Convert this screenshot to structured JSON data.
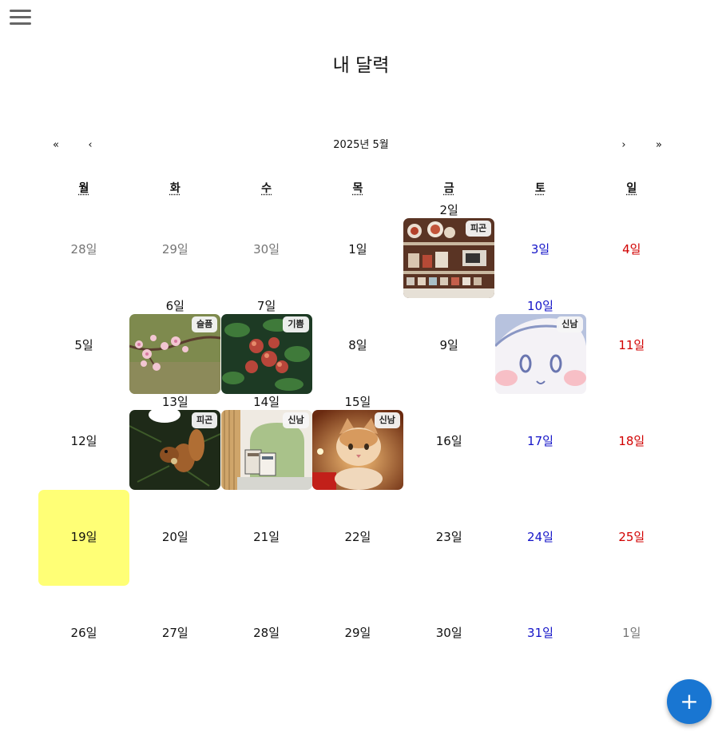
{
  "title": "내 달력",
  "nav": {
    "prev_year": "«",
    "prev_month": "‹",
    "month_label": "2025년 5월",
    "next_month": "›",
    "next_year": "»"
  },
  "weekdays": [
    "월",
    "화",
    "수",
    "목",
    "금",
    "토",
    "일"
  ],
  "weeks": [
    [
      {
        "label": "28일",
        "color": "grey"
      },
      {
        "label": "29일",
        "color": "grey"
      },
      {
        "label": "30일",
        "color": "grey"
      },
      {
        "label": "1일",
        "color": "black"
      },
      {
        "label": "2일",
        "color": "black",
        "tag": "피곤",
        "photo": "kitchen-shelves"
      },
      {
        "label": "3일",
        "color": "blue"
      },
      {
        "label": "4일",
        "color": "red"
      }
    ],
    [
      {
        "label": "5일",
        "color": "black"
      },
      {
        "label": "6일",
        "color": "black",
        "tag": "슬픔",
        "photo": "cherry-blossom"
      },
      {
        "label": "7일",
        "color": "black",
        "tag": "기쁨",
        "photo": "apple-tree"
      },
      {
        "label": "8일",
        "color": "black"
      },
      {
        "label": "9일",
        "color": "black"
      },
      {
        "label": "10일",
        "color": "blue",
        "tag": "신남",
        "photo": "cartoon-face"
      },
      {
        "label": "11일",
        "color": "red"
      }
    ],
    [
      {
        "label": "12일",
        "color": "black"
      },
      {
        "label": "13일",
        "color": "black",
        "tag": "피곤",
        "photo": "squirrel"
      },
      {
        "label": "14일",
        "color": "black",
        "tag": "신남",
        "photo": "books-chair"
      },
      {
        "label": "15일",
        "color": "black",
        "tag": "신남",
        "photo": "kitten"
      },
      {
        "label": "16일",
        "color": "black"
      },
      {
        "label": "17일",
        "color": "blue"
      },
      {
        "label": "18일",
        "color": "red"
      }
    ],
    [
      {
        "label": "19일",
        "color": "black",
        "today": true
      },
      {
        "label": "20일",
        "color": "black"
      },
      {
        "label": "21일",
        "color": "black"
      },
      {
        "label": "22일",
        "color": "black"
      },
      {
        "label": "23일",
        "color": "black"
      },
      {
        "label": "24일",
        "color": "blue"
      },
      {
        "label": "25일",
        "color": "red"
      }
    ],
    [
      {
        "label": "26일",
        "color": "black"
      },
      {
        "label": "27일",
        "color": "black"
      },
      {
        "label": "28일",
        "color": "black"
      },
      {
        "label": "29일",
        "color": "black"
      },
      {
        "label": "30일",
        "color": "black"
      },
      {
        "label": "31일",
        "color": "blue"
      },
      {
        "label": "1일",
        "color": "grey"
      }
    ]
  ],
  "fab_label": "+",
  "colors": {
    "today": "#ffff76",
    "weekend_sat": "#1414c8",
    "weekend_sun": "#d10000",
    "fab": "#1976d2"
  },
  "icons": {
    "menu": "hamburger-menu-icon",
    "add": "plus-icon"
  }
}
